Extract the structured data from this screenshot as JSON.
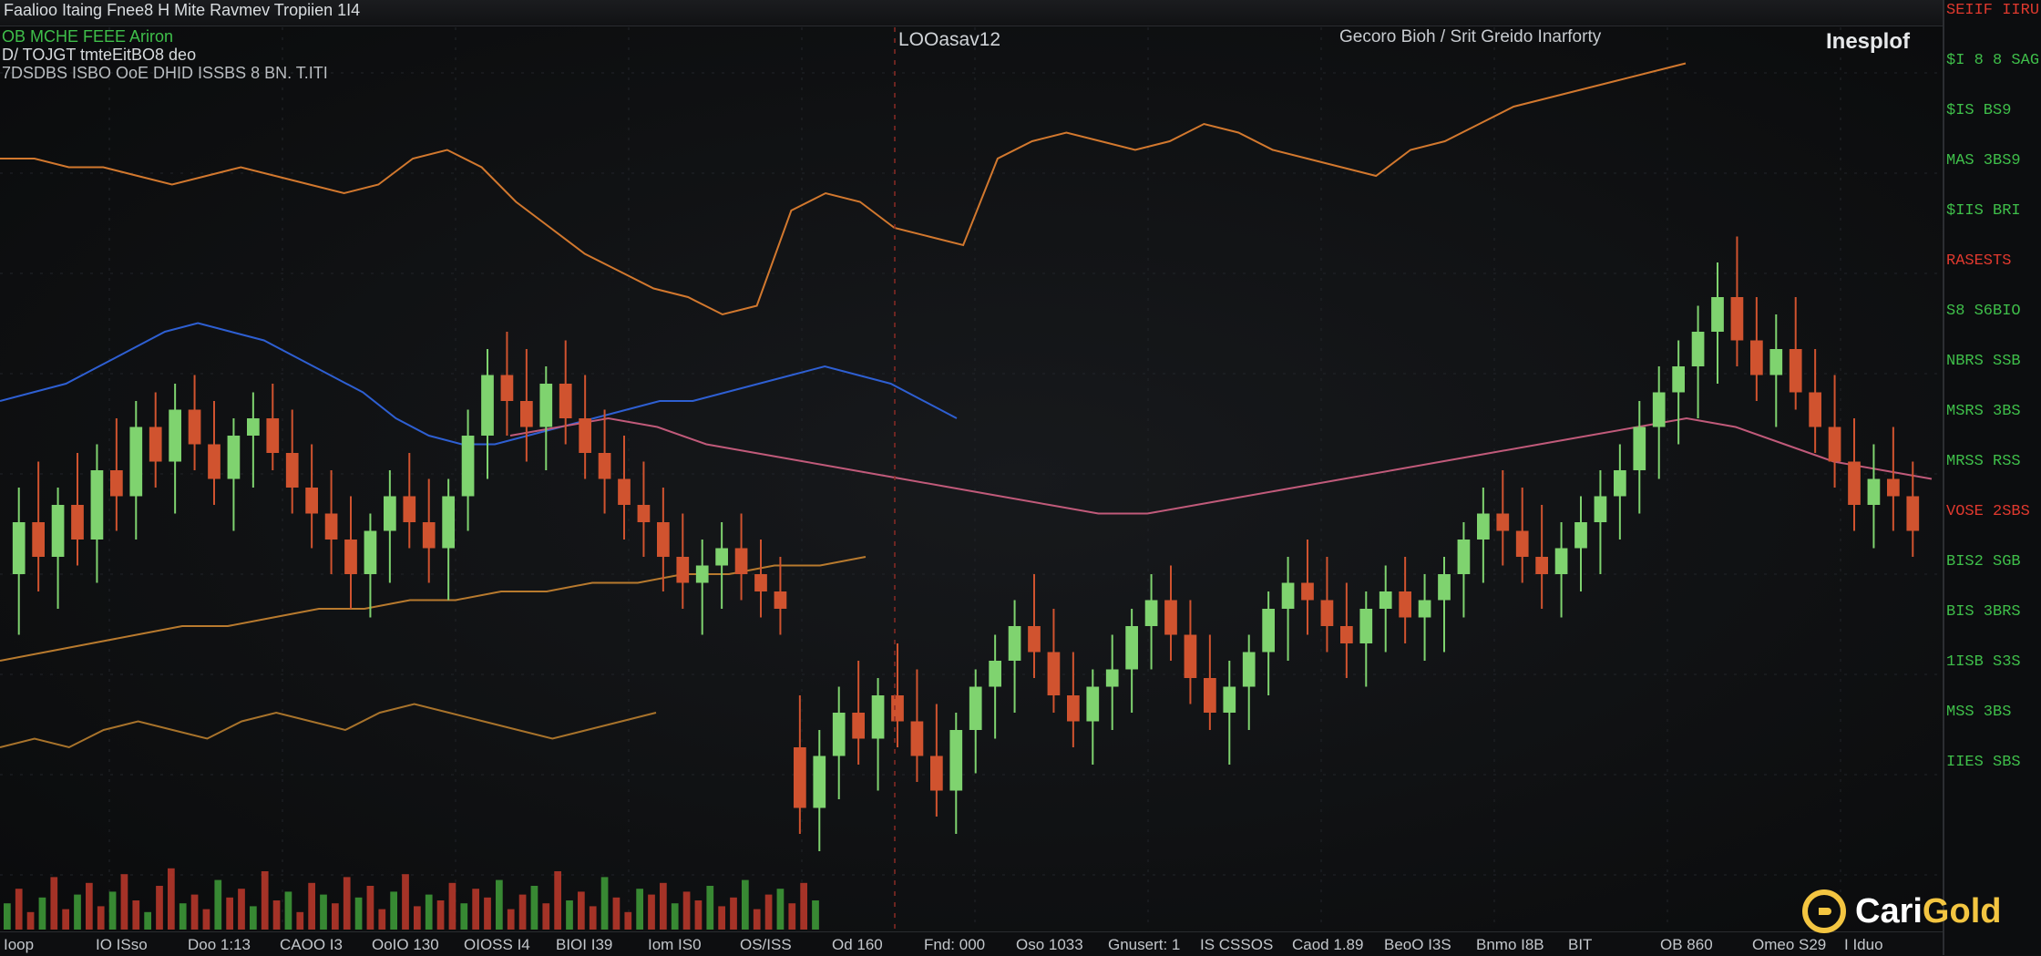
{
  "header": {
    "ticker_line_1": "Faalioo Itaing Fnee8 H Mite Ravmev Tropiien 1I4",
    "info_line_1": "OB MCHE FEEE Ariron",
    "info_line_2": "D/ TOJGT tmteEitBO8 deo",
    "info_line_3": "7DSDBS ISBO OoE DHID ISSBS 8 BN. T.ITI",
    "center_label": "LOOasav12",
    "right_label": "Gecoro Bioh / Srit Greido Inarforty",
    "top_right_label": "Inesplof"
  },
  "price_axis": {
    "labels": [
      {
        "text": "SEIIF IIRU",
        "color": "#e0392e"
      },
      {
        "text": "$I 8 8 SAG",
        "color": "#3fbf4a"
      },
      {
        "text": "$IS BS9",
        "color": "#3fbf4a"
      },
      {
        "text": "MAS 3BS9",
        "color": "#3fbf4a"
      },
      {
        "text": "$IIS BRI",
        "color": "#3fbf4a"
      },
      {
        "text": "RASESTS",
        "color": "#e0392e"
      },
      {
        "text": "S8 S6BIO",
        "color": "#3fbf4a"
      },
      {
        "text": "NBRS SSB",
        "color": "#3fbf4a"
      },
      {
        "text": "MSRS 3BS",
        "color": "#3fbf4a"
      },
      {
        "text": "MRSS RSS",
        "color": "#3fbf4a"
      },
      {
        "text": "VOSE 2SBS",
        "color": "#e0392e"
      },
      {
        "text": "BIS2 SGB",
        "color": "#3fbf4a"
      },
      {
        "text": "BIS 3BRS",
        "color": "#3fbf4a"
      },
      {
        "text": "1ISB S3S",
        "color": "#3fbf4a"
      },
      {
        "text": "MSS 3BS",
        "color": "#3fbf4a"
      },
      {
        "text": "IIES SBS",
        "color": "#3fbf4a"
      }
    ]
  },
  "time_axis": {
    "labels": [
      "Ioop",
      "IO ISso",
      "Doo 1:13",
      "CAOO I3",
      "OoIO 130",
      "OIOSS I4",
      "BIOI I39",
      "Iom IS0",
      "OS/ISS",
      "Od 160",
      "Fnd: 000",
      "Oso 1033",
      "Gnusert: 1",
      "IS CSSOS",
      "Caod 1.89",
      "BeoO I3S",
      "Bnmo I8B",
      "BIT",
      "OB 860",
      "Omeo S29",
      "I Iduo"
    ]
  },
  "watermark": {
    "brand_part_1": "Cari",
    "brand_part_2": "Gold"
  },
  "chart_data": {
    "type": "candlestick",
    "title": "",
    "xlabel": "",
    "ylabel": "",
    "ylim": [
      0,
      100
    ],
    "grid": true,
    "colors": {
      "up": "#7fd36f",
      "down": "#d0532f",
      "background": "#0f1012",
      "grid": "#22252a"
    },
    "candles": [
      {
        "o": 40,
        "h": 50,
        "l": 33,
        "c": 46
      },
      {
        "o": 46,
        "h": 53,
        "l": 38,
        "c": 42
      },
      {
        "o": 42,
        "h": 50,
        "l": 36,
        "c": 48
      },
      {
        "o": 48,
        "h": 54,
        "l": 41,
        "c": 44
      },
      {
        "o": 44,
        "h": 55,
        "l": 39,
        "c": 52
      },
      {
        "o": 52,
        "h": 58,
        "l": 45,
        "c": 49
      },
      {
        "o": 49,
        "h": 60,
        "l": 44,
        "c": 57
      },
      {
        "o": 57,
        "h": 61,
        "l": 50,
        "c": 53
      },
      {
        "o": 53,
        "h": 62,
        "l": 47,
        "c": 59
      },
      {
        "o": 59,
        "h": 63,
        "l": 52,
        "c": 55
      },
      {
        "o": 55,
        "h": 60,
        "l": 48,
        "c": 51
      },
      {
        "o": 51,
        "h": 58,
        "l": 45,
        "c": 56
      },
      {
        "o": 56,
        "h": 61,
        "l": 50,
        "c": 58
      },
      {
        "o": 58,
        "h": 62,
        "l": 52,
        "c": 54
      },
      {
        "o": 54,
        "h": 59,
        "l": 47,
        "c": 50
      },
      {
        "o": 50,
        "h": 55,
        "l": 43,
        "c": 47
      },
      {
        "o": 47,
        "h": 52,
        "l": 40,
        "c": 44
      },
      {
        "o": 44,
        "h": 49,
        "l": 36,
        "c": 40
      },
      {
        "o": 40,
        "h": 47,
        "l": 35,
        "c": 45
      },
      {
        "o": 45,
        "h": 52,
        "l": 39,
        "c": 49
      },
      {
        "o": 49,
        "h": 54,
        "l": 43,
        "c": 46
      },
      {
        "o": 46,
        "h": 51,
        "l": 39,
        "c": 43
      },
      {
        "o": 43,
        "h": 51,
        "l": 37,
        "c": 49
      },
      {
        "o": 49,
        "h": 59,
        "l": 45,
        "c": 56
      },
      {
        "o": 56,
        "h": 66,
        "l": 51,
        "c": 63
      },
      {
        "o": 63,
        "h": 68,
        "l": 56,
        "c": 60
      },
      {
        "o": 60,
        "h": 66,
        "l": 53,
        "c": 57
      },
      {
        "o": 57,
        "h": 64,
        "l": 52,
        "c": 62
      },
      {
        "o": 62,
        "h": 67,
        "l": 55,
        "c": 58
      },
      {
        "o": 58,
        "h": 63,
        "l": 51,
        "c": 54
      },
      {
        "o": 54,
        "h": 59,
        "l": 47,
        "c": 51
      },
      {
        "o": 51,
        "h": 56,
        "l": 44,
        "c": 48
      },
      {
        "o": 48,
        "h": 53,
        "l": 42,
        "c": 46
      },
      {
        "o": 46,
        "h": 50,
        "l": 38,
        "c": 42
      },
      {
        "o": 42,
        "h": 47,
        "l": 36,
        "c": 39
      },
      {
        "o": 39,
        "h": 44,
        "l": 33,
        "c": 41
      },
      {
        "o": 41,
        "h": 46,
        "l": 36,
        "c": 43
      },
      {
        "o": 43,
        "h": 47,
        "l": 37,
        "c": 40
      },
      {
        "o": 40,
        "h": 44,
        "l": 35,
        "c": 38
      },
      {
        "o": 38,
        "h": 42,
        "l": 33,
        "c": 36
      },
      {
        "o": 20,
        "h": 26,
        "l": 10,
        "c": 13
      },
      {
        "o": 13,
        "h": 22,
        "l": 8,
        "c": 19
      },
      {
        "o": 19,
        "h": 27,
        "l": 14,
        "c": 24
      },
      {
        "o": 24,
        "h": 30,
        "l": 18,
        "c": 21
      },
      {
        "o": 21,
        "h": 28,
        "l": 15,
        "c": 26
      },
      {
        "o": 26,
        "h": 32,
        "l": 20,
        "c": 23
      },
      {
        "o": 23,
        "h": 29,
        "l": 16,
        "c": 19
      },
      {
        "o": 19,
        "h": 25,
        "l": 12,
        "c": 15
      },
      {
        "o": 15,
        "h": 24,
        "l": 10,
        "c": 22
      },
      {
        "o": 22,
        "h": 29,
        "l": 17,
        "c": 27
      },
      {
        "o": 27,
        "h": 33,
        "l": 21,
        "c": 30
      },
      {
        "o": 30,
        "h": 37,
        "l": 24,
        "c": 34
      },
      {
        "o": 34,
        "h": 40,
        "l": 28,
        "c": 31
      },
      {
        "o": 31,
        "h": 36,
        "l": 24,
        "c": 26
      },
      {
        "o": 26,
        "h": 31,
        "l": 20,
        "c": 23
      },
      {
        "o": 23,
        "h": 29,
        "l": 18,
        "c": 27
      },
      {
        "o": 27,
        "h": 33,
        "l": 22,
        "c": 29
      },
      {
        "o": 29,
        "h": 36,
        "l": 24,
        "c": 34
      },
      {
        "o": 34,
        "h": 40,
        "l": 29,
        "c": 37
      },
      {
        "o": 37,
        "h": 41,
        "l": 30,
        "c": 33
      },
      {
        "o": 33,
        "h": 37,
        "l": 25,
        "c": 28
      },
      {
        "o": 28,
        "h": 33,
        "l": 22,
        "c": 24
      },
      {
        "o": 24,
        "h": 30,
        "l": 18,
        "c": 27
      },
      {
        "o": 27,
        "h": 33,
        "l": 22,
        "c": 31
      },
      {
        "o": 31,
        "h": 38,
        "l": 26,
        "c": 36
      },
      {
        "o": 36,
        "h": 42,
        "l": 30,
        "c": 39
      },
      {
        "o": 39,
        "h": 44,
        "l": 33,
        "c": 37
      },
      {
        "o": 37,
        "h": 42,
        "l": 31,
        "c": 34
      },
      {
        "o": 34,
        "h": 39,
        "l": 28,
        "c": 32
      },
      {
        "o": 32,
        "h": 38,
        "l": 27,
        "c": 36
      },
      {
        "o": 36,
        "h": 41,
        "l": 31,
        "c": 38
      },
      {
        "o": 38,
        "h": 42,
        "l": 32,
        "c": 35
      },
      {
        "o": 35,
        "h": 40,
        "l": 30,
        "c": 37
      },
      {
        "o": 37,
        "h": 42,
        "l": 31,
        "c": 40
      },
      {
        "o": 40,
        "h": 46,
        "l": 35,
        "c": 44
      },
      {
        "o": 44,
        "h": 50,
        "l": 39,
        "c": 47
      },
      {
        "o": 47,
        "h": 52,
        "l": 41,
        "c": 45
      },
      {
        "o": 45,
        "h": 50,
        "l": 39,
        "c": 42
      },
      {
        "o": 42,
        "h": 48,
        "l": 36,
        "c": 40
      },
      {
        "o": 40,
        "h": 46,
        "l": 35,
        "c": 43
      },
      {
        "o": 43,
        "h": 49,
        "l": 38,
        "c": 46
      },
      {
        "o": 46,
        "h": 52,
        "l": 40,
        "c": 49
      },
      {
        "o": 49,
        "h": 55,
        "l": 44,
        "c": 52
      },
      {
        "o": 52,
        "h": 60,
        "l": 47,
        "c": 57
      },
      {
        "o": 57,
        "h": 64,
        "l": 51,
        "c": 61
      },
      {
        "o": 61,
        "h": 67,
        "l": 55,
        "c": 64
      },
      {
        "o": 64,
        "h": 71,
        "l": 58,
        "c": 68
      },
      {
        "o": 68,
        "h": 76,
        "l": 62,
        "c": 72
      },
      {
        "o": 72,
        "h": 79,
        "l": 64,
        "c": 67
      },
      {
        "o": 67,
        "h": 72,
        "l": 60,
        "c": 63
      },
      {
        "o": 63,
        "h": 70,
        "l": 57,
        "c": 66
      },
      {
        "o": 66,
        "h": 72,
        "l": 59,
        "c": 61
      },
      {
        "o": 61,
        "h": 66,
        "l": 54,
        "c": 57
      },
      {
        "o": 57,
        "h": 63,
        "l": 50,
        "c": 53
      },
      {
        "o": 53,
        "h": 58,
        "l": 45,
        "c": 48
      },
      {
        "o": 48,
        "h": 55,
        "l": 43,
        "c": 51
      },
      {
        "o": 51,
        "h": 57,
        "l": 45,
        "c": 49
      },
      {
        "o": 49,
        "h": 53,
        "l": 42,
        "c": 45
      }
    ],
    "volume": [
      9,
      14,
      6,
      11,
      18,
      7,
      12,
      16,
      8,
      13,
      19,
      10,
      6,
      15,
      21,
      9,
      12,
      7,
      17,
      11,
      14,
      8,
      20,
      10,
      13,
      6,
      16,
      12,
      9,
      18,
      11,
      15,
      7,
      13,
      19,
      8,
      12,
      10,
      16,
      9,
      14,
      11,
      17,
      7,
      12,
      15,
      9,
      20,
      10,
      13,
      8,
      18,
      11,
      6,
      14,
      12,
      16,
      9,
      13,
      10,
      15,
      8,
      11,
      17,
      7,
      12,
      14,
      9,
      16,
      10
    ],
    "series": [
      {
        "color": "#d2782e",
        "values": [
          88,
          88,
          87,
          87,
          86,
          85,
          86,
          87,
          86,
          85,
          84,
          85,
          88,
          89,
          87,
          83,
          80,
          77,
          75,
          73,
          72,
          70,
          71,
          82,
          84,
          83,
          80,
          79,
          78,
          88,
          90,
          91,
          90,
          89,
          90,
          92,
          91,
          89,
          88,
          87,
          86,
          89,
          90,
          92,
          94,
          95,
          96,
          97,
          98,
          99
        ]
      },
      {
        "color": "#2e5fd2",
        "values": [
          60,
          61,
          62,
          64,
          66,
          68,
          69,
          68,
          67,
          65,
          63,
          61,
          58,
          56,
          55,
          55,
          56,
          57,
          58,
          59,
          60,
          60,
          61,
          62,
          63,
          64,
          63,
          62,
          60,
          58
        ]
      },
      {
        "color": "#c05a7a",
        "values": [
          56,
          57,
          58,
          57,
          55,
          54,
          53,
          52,
          51,
          50,
          49,
          48,
          47,
          47,
          48,
          49,
          50,
          51,
          52,
          53,
          54,
          55,
          56,
          57,
          58,
          57,
          55,
          53,
          52,
          51
        ]
      },
      {
        "color": "#b87a2e",
        "values": [
          30,
          31,
          32,
          33,
          34,
          34,
          35,
          36,
          36,
          37,
          37,
          38,
          38,
          39,
          39,
          40,
          40,
          41,
          41,
          42
        ]
      },
      {
        "color": "#a8732b",
        "values": [
          20,
          21,
          20,
          22,
          23,
          22,
          21,
          23,
          24,
          23,
          22,
          24,
          25,
          24,
          23,
          22,
          21,
          22,
          23,
          24
        ]
      }
    ]
  }
}
